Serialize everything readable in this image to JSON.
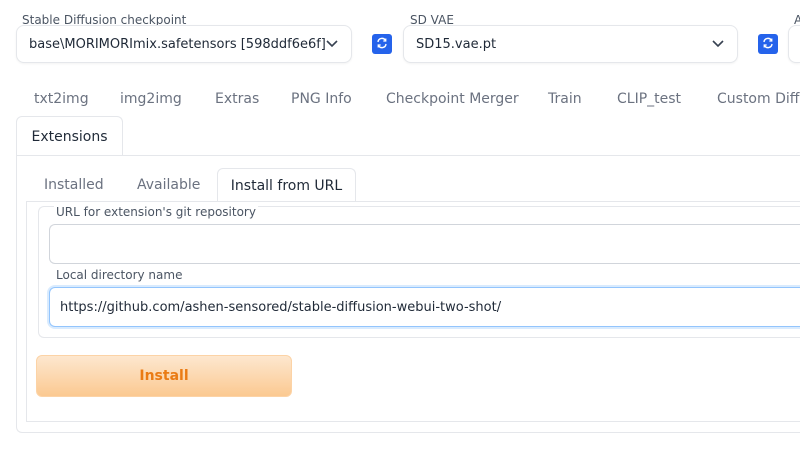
{
  "settings": {
    "checkpoint": {
      "label": "Stable Diffusion checkpoint",
      "value": "base\\MORIMORImix.safetensors [598ddf6e6f]"
    },
    "vae": {
      "label": "SD VAE",
      "value": "SD15.vae.pt"
    },
    "extra_label": "A"
  },
  "main_tabs": [
    {
      "label": "txt2img"
    },
    {
      "label": "img2img"
    },
    {
      "label": "Extras"
    },
    {
      "label": "PNG Info"
    },
    {
      "label": "Checkpoint Merger"
    },
    {
      "label": "Train"
    },
    {
      "label": "CLIP_test"
    },
    {
      "label": "Custom Diffu"
    }
  ],
  "active_main_tab": "Extensions",
  "sub_tabs": [
    {
      "label": "Installed"
    },
    {
      "label": "Available"
    },
    {
      "label": "Install from URL"
    }
  ],
  "form": {
    "url_label": "URL for extension's git repository",
    "url_value": "",
    "dir_label": "Local directory name",
    "dir_value": "https://github.com/ashen-sensored/stable-diffusion-webui-two-shot/",
    "install_label": "Install"
  },
  "colors": {
    "accent_blue": "#2563eb",
    "install_text": "#ea7b14",
    "install_bg": "#fbc991"
  }
}
